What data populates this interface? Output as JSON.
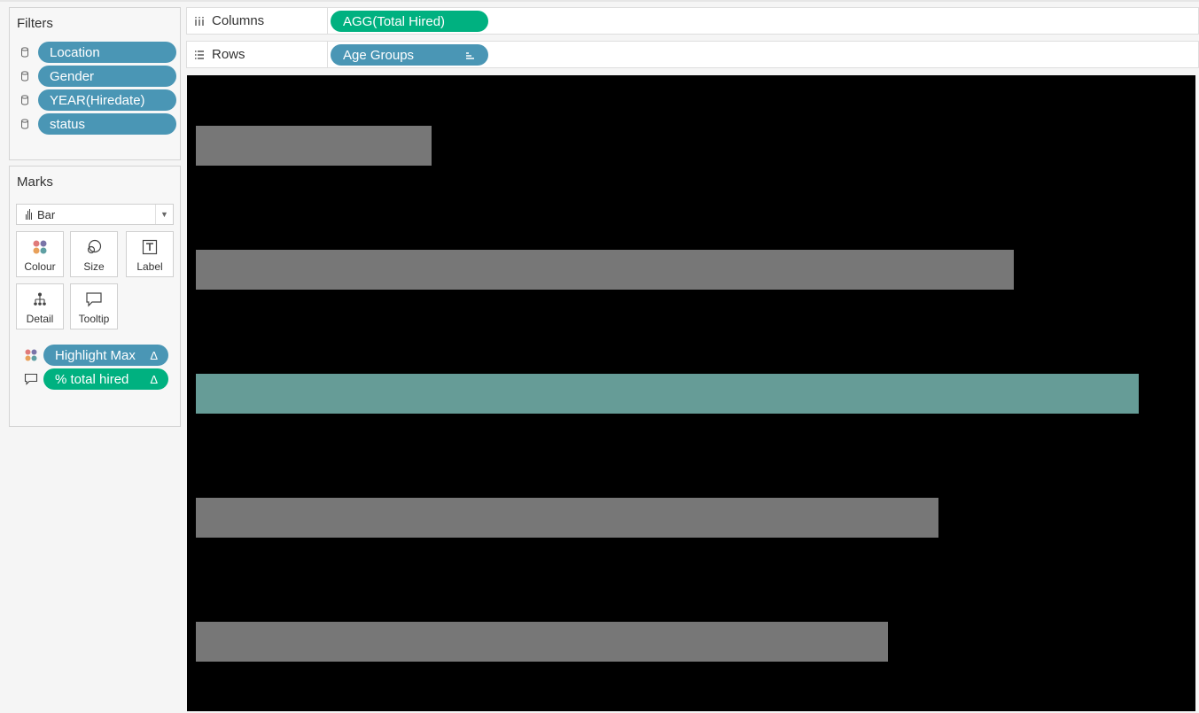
{
  "filters": {
    "title": "Filters",
    "items": [
      {
        "label": "Location"
      },
      {
        "label": "Gender"
      },
      {
        "label": "YEAR(Hiredate)"
      },
      {
        "label": "status"
      }
    ]
  },
  "marks": {
    "title": "Marks",
    "mark_type": "Bar",
    "buttons": {
      "colour": "Colour",
      "size": "Size",
      "label": "Label",
      "detail": "Detail",
      "tooltip": "Tooltip"
    },
    "encodings": [
      {
        "label": "Highlight Max",
        "delta": "Δ",
        "type": "colour",
        "pill_color": "#4a96b5"
      },
      {
        "label": "% total hired",
        "delta": "Δ",
        "type": "tooltip",
        "pill_color": "#00b180"
      }
    ]
  },
  "shelves": {
    "columns": {
      "label": "Columns",
      "pill": "AGG(Total Hired)",
      "pill_color": "#00b180"
    },
    "rows": {
      "label": "Rows",
      "pill": "Age Groups",
      "pill_color": "#4a96b5"
    }
  },
  "chart_data": {
    "type": "bar",
    "orientation": "horizontal",
    "background": "#000000",
    "values": [
      0.234,
      0.811,
      0.935,
      0.736,
      0.686
    ],
    "value_units": "fraction of largest axis extent (no axis shown)",
    "highlight_index": 2,
    "bar_color": "#777777",
    "highlight_color": "#669c97",
    "axes_visible": false,
    "grid": false
  }
}
